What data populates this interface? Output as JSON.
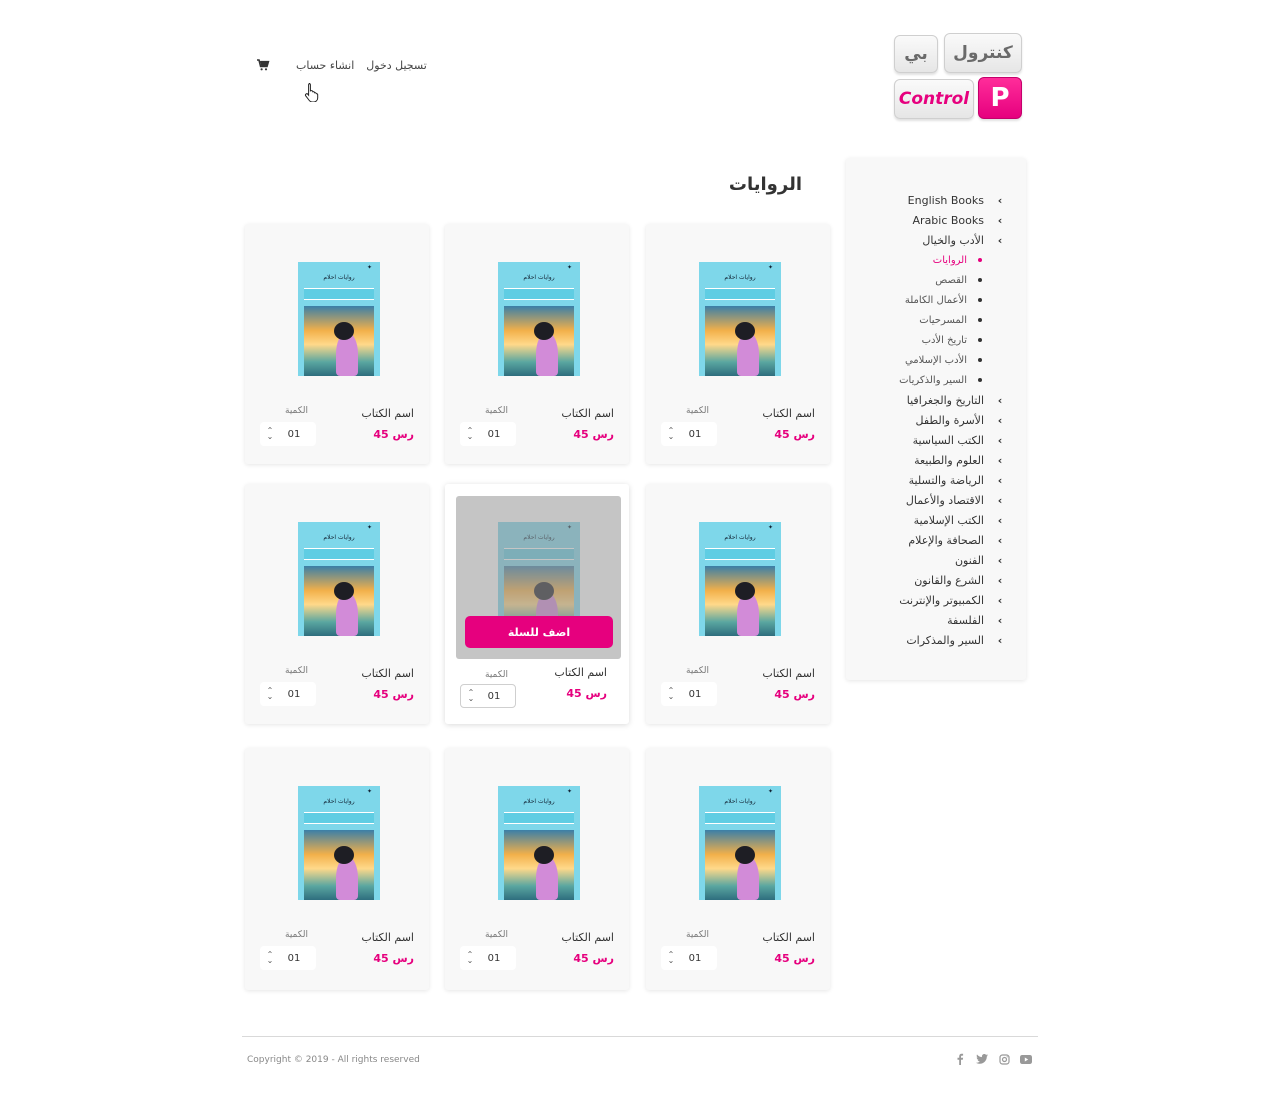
{
  "header": {
    "login_label": "تسجيل دخول",
    "register_label": "انشاء حساب",
    "cart_icon": "cart-icon",
    "logo": {
      "text_ar_1": "كنترول",
      "text_ar_2": "بي",
      "text_en": "Control",
      "letter": "P"
    }
  },
  "page_title": "الروايات",
  "sidebar": {
    "items": [
      {
        "label": "English Books"
      },
      {
        "label": "Arabic Books"
      },
      {
        "label": "الأدب والخيال"
      }
    ],
    "sub_items": [
      {
        "label": "الروايات",
        "active": true
      },
      {
        "label": "القصص"
      },
      {
        "label": "الأعمال الكاملة"
      },
      {
        "label": "المسرحيات"
      },
      {
        "label": "تاريخ الأدب"
      },
      {
        "label": "الأدب الإسلامي"
      },
      {
        "label": "السير والذكريات"
      }
    ],
    "items_after": [
      {
        "label": "التاريخ والجغرافيا"
      },
      {
        "label": "الأسرة والطفل"
      },
      {
        "label": "الكتب السياسية"
      },
      {
        "label": "العلوم والطبيعة"
      },
      {
        "label": "الرياضة والتسلية"
      },
      {
        "label": "الاقتصاد والأعمال"
      },
      {
        "label": "الكتب الإسلامية"
      },
      {
        "label": "الصحافة والإعلام"
      },
      {
        "label": "الفنون"
      },
      {
        "label": "الشرع والقانون"
      },
      {
        "label": "الكمبيوتر والإنترنت"
      },
      {
        "label": "الفلسفة"
      },
      {
        "label": "السير والمذكرات"
      }
    ]
  },
  "product": {
    "name": "اسم الكتاب",
    "qty_label": "الكمية",
    "price": "45 رس",
    "qty_value": "01",
    "cover_title": "روايات احلام",
    "add_to_cart": "اضف للسلة"
  },
  "products_count": 9,
  "hovered_index": 4,
  "footer": {
    "copyright": "Copyright © 2019 - All rights reserved",
    "social_icons": [
      "facebook-icon",
      "twitter-icon",
      "instagram-icon",
      "youtube-icon"
    ]
  },
  "colors": {
    "accent": "#e6007e",
    "card_bg": "#f8f8f8"
  }
}
